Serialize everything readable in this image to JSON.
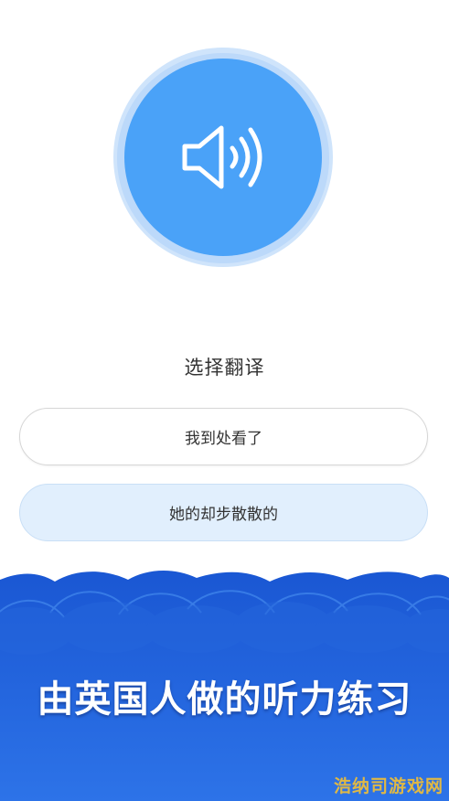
{
  "speaker": {
    "icon": "speaker-volume-icon",
    "color": "#4aa2f8"
  },
  "question": {
    "prompt": "选择翻译"
  },
  "options": [
    {
      "label": "我到处看了"
    },
    {
      "label": "她的却步散散的"
    }
  ],
  "banner": {
    "headline": "由英国人做的听力练习",
    "background_top": "#1e5ed8",
    "background_bottom": "#2a6fe6"
  },
  "watermark": {
    "text": "浩纳司游戏网"
  }
}
